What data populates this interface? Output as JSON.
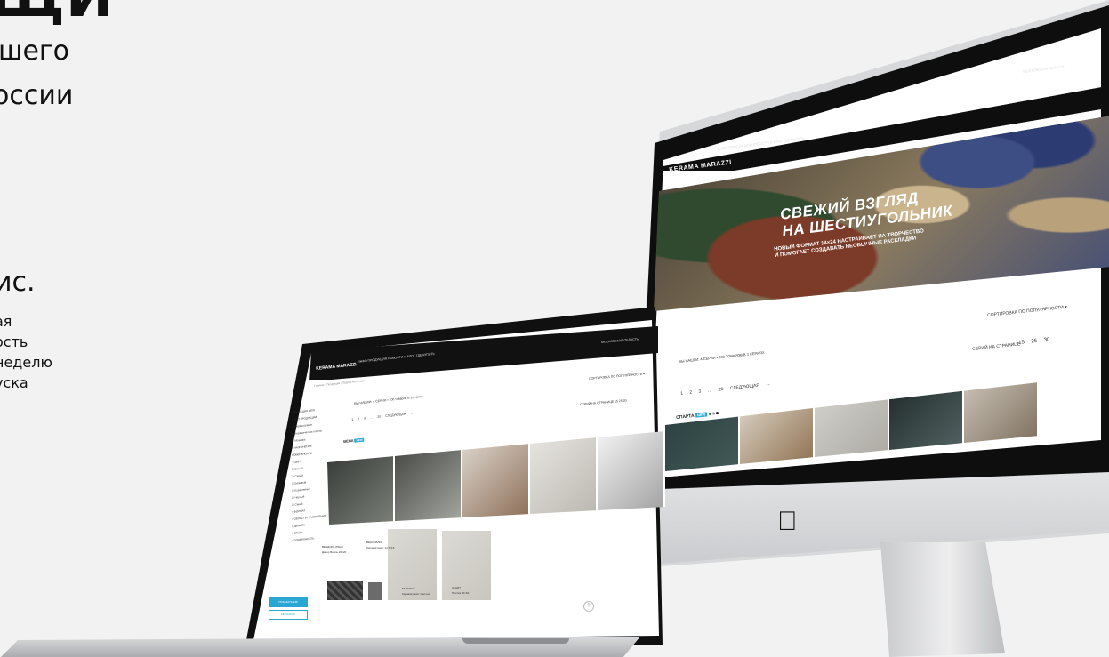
{
  "promo": {
    "title_fragment": "ЩИ",
    "line1": "шего",
    "line2": "оссии",
    "stat_fragment": "ис.",
    "description": "ая\nость\nнеделю\nуска"
  },
  "imac": {
    "logo": "KERAMA MARAZZI",
    "menu": "ИНФО   ПРОДУКЦИЯ   НОВОСТИ И БЛОГ   ГДЕ КУПИТЬ",
    "region": "МОСКОВСКАЯ ОБЛАСТЬ",
    "hero_title_line1": "СВЕЖИЙ ВЗГЛЯД",
    "hero_title_line2": "НА ШЕСТИУГОЛЬНИК",
    "hero_sub_line1": "НОВЫЙ ФОРМАТ 14×24 НАСТРАИВАЕТ НА ТВОРЧЕСТВО",
    "hero_sub_line2": "И ПОМОГАЕТ СОЗДАВАТЬ НЕОБЫЧНЫЕ РАСКЛАДКИ",
    "sort_label": "СОРТИРОВКА ПО ПОПУЛЯРНОСТИ ▾",
    "per_page_label": "СЕРИЙ НА СТРАНИЦЕ",
    "per_page_options": "15  25  30",
    "found_text": "ВЫ НАШЛИ: 4 СЕРИИ • 200 ТОВАРОВ В 3 СЕРИЯХ",
    "pages": "1  2  3  …  20  СЛЕДУЮЩАЯ →",
    "series_name": "СПАРТА",
    "series_badge": "NEW"
  },
  "laptop": {
    "logo": "KERAMA MARAZZI",
    "menu": "ИНФО   ПРОДУКЦИЯ   НОВОСТИ И БЛОГ   ГДЕ КУПИТЬ",
    "region": "МОСКОВСКАЯ ОБЛАСТЬ",
    "breadcrumb": "Главная › Продукция › Подбор коллекции",
    "sort_label": "СОРТИРОВКА ПО ПОПУЛЯРНОСТИ ▾",
    "found_text": "ВЫ НАШЛИ: 4 СЕРИИ • 100 товаров В 3 сериях",
    "per_page_label": "СЕРИЙ НА СТРАНИЦЕ  15  25  30",
    "pages": "1  2  3  …  20  СЛЕДУЮЩАЯ →",
    "series_name": "ВЕНА",
    "series_badge": "NEW",
    "sidebar": "КОЛЛЕКЦИЯ NEW\n− ТИП ПРОДУКЦИИ\n☐ Керамогранит\n☐ Керамическая плитка\n☐ Мозаика\n+ НАЗНАЧЕНИЕ ПОВЕРХНОСТИ\n− ЦВЕТ\n☐ Белый\n☐ Серый\n☐ Бежевый\n☐ Коричневый\n☐ Черный\n☐ Синий\n+ ФОРМАТ\n+ ОБЛАСТЬ ПРИМЕНЕНИЯ\n+ ДИЗАЙН\n+ СТИЛЬ\n+ ПОВЕРХНОСТЬ",
    "show_button": "ПОКАЗАТЬ 248",
    "reset_button": "СБРОСИТЬ",
    "tile1_name": "ВЕНДОРА ЛЮКС",
    "tile1_desc": "Декор Вилль 20×20",
    "tile2_name": "ВЕНСИАЛО",
    "tile2_desc": "Керамогранит 14,7×15",
    "tile3_name": "БЕРЛИНО",
    "tile3_desc": "Керамогранит светлый",
    "tile4_name": "ЗЕНИТ",
    "tile4_desc": "Плитка 30×60",
    "help": "?"
  },
  "colors": {
    "accent": "#29a6d3",
    "background": "#f2f2f2",
    "bezel": "#0e0e0e"
  }
}
